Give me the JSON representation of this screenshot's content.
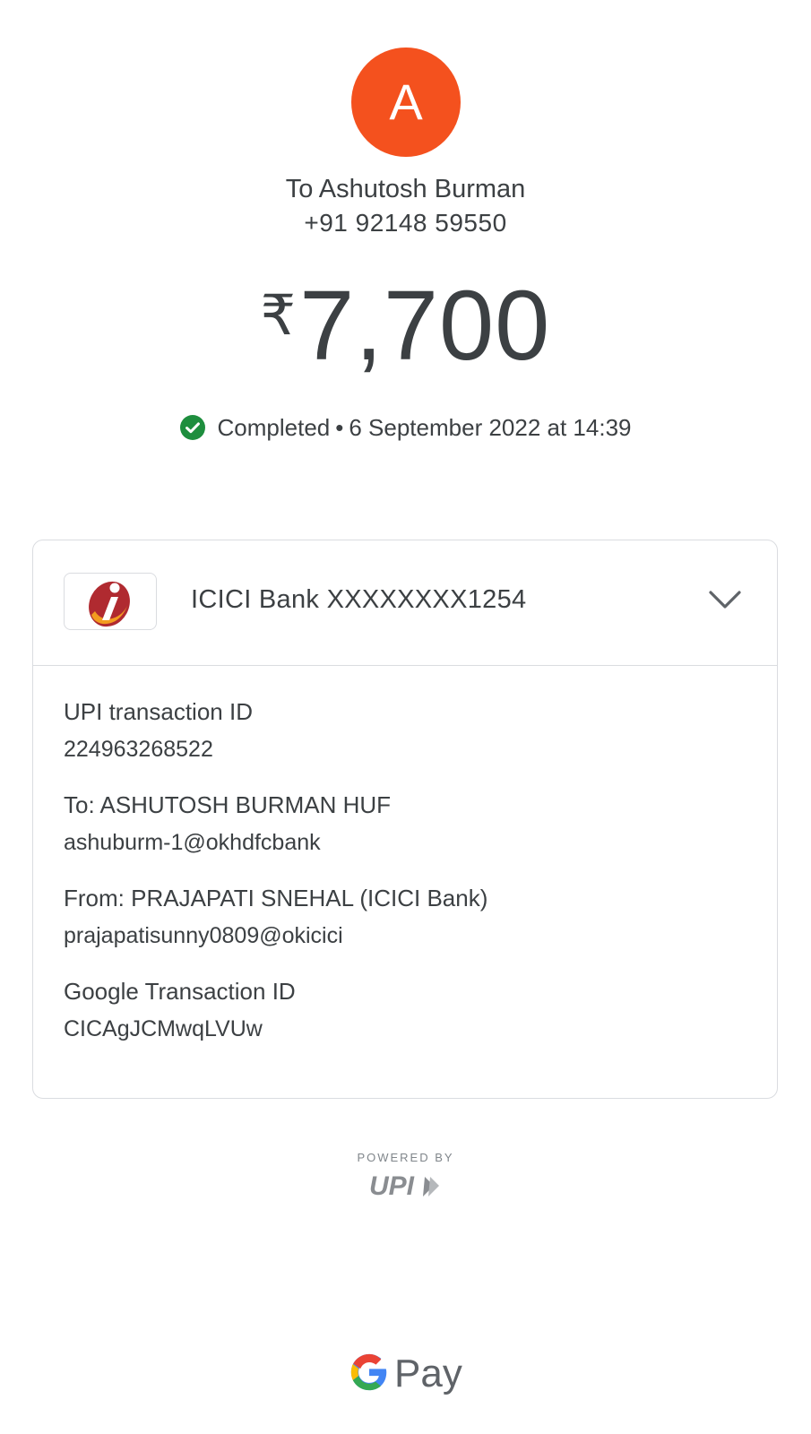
{
  "payee": {
    "avatar_letter": "A",
    "avatar_color": "#f4511e",
    "name": "To Ashutosh Burman",
    "phone": "+91 92148 59550"
  },
  "payment": {
    "currency_symbol": "₹",
    "amount": "7,700",
    "status": "Completed",
    "separator": "•",
    "datetime": "6 September 2022 at 14:39",
    "status_color": "#1e8e3e"
  },
  "account": {
    "bank_label": "ICICI Bank XXXXXXXX1254",
    "logo_icon": "icici-bank-logo"
  },
  "details": [
    {
      "label": "UPI transaction ID",
      "value": "224963268522"
    },
    {
      "label": "To: ASHUTOSH BURMAN HUF",
      "value": "ashuburm-1@okhdfcbank"
    },
    {
      "label": "From: PRAJAPATI SNEHAL (ICICI Bank)",
      "value": "prajapatisunny0809@okicici"
    },
    {
      "label": "Google Transaction ID",
      "value": "CICAgJCMwqLVUw"
    }
  ],
  "footer": {
    "powered_by": "POWERED BY",
    "upi_logo_text": "UPI",
    "brand_text": "Pay"
  }
}
